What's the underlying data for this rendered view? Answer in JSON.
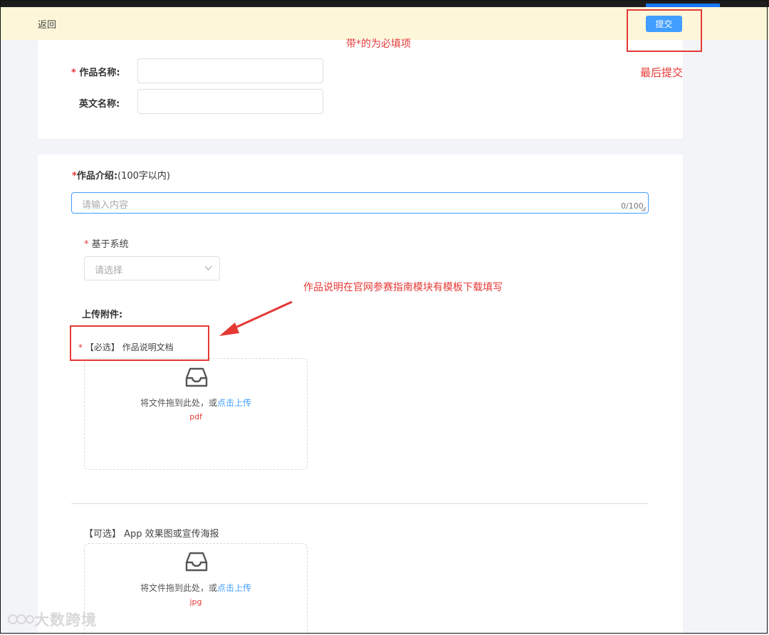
{
  "header": {
    "back_label": "返回",
    "submit_label": "提交"
  },
  "annotations": {
    "required_note": "带*的为必填项",
    "submit_note": "最后提交",
    "doc_note": "作品说明在官网参赛指南模块有模板下载填写"
  },
  "basic": {
    "name_label": "作品名称:",
    "name_value": "",
    "english_label": "英文名称:",
    "english_value": ""
  },
  "intro": {
    "label": "作品介绍:",
    "hint": "(100字以内)",
    "placeholder": "请输入内容",
    "counter": "0/100",
    "system_label": "基于系统",
    "system_placeholder": "请选择"
  },
  "attachments": {
    "title": "上传附件:",
    "required_doc_label": "【必选】 作品说明文档",
    "optional_label": "【可选】 App 效果图或宣传海报",
    "drop_text": "将文件拖到此处，或",
    "click_upload": "点击上传",
    "required_type": "pdf",
    "optional_type": "jpg"
  },
  "watermark": "大数跨境",
  "colors": {
    "accent": "#409eff",
    "annotation": "#e53935",
    "header_bg": "#fdf6d9"
  }
}
